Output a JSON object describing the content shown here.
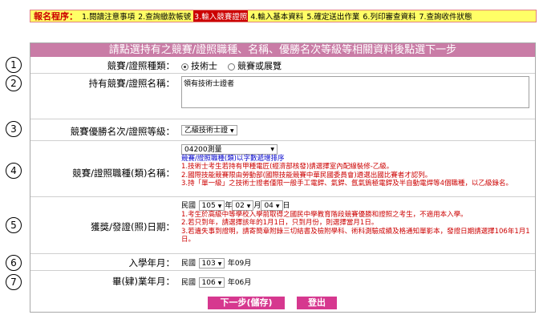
{
  "steps": {
    "label": "報名程序：",
    "items": [
      "1.閱讀注意事項",
      "2.查詢繳款帳號",
      "3.輸入競賽證照",
      "4.輸入基本資料",
      "5.確定送出作業",
      "6.列印審查資料",
      "7.查詢收件狀態"
    ],
    "active_index": 2
  },
  "header": {
    "title": "請點選持有之競賽/證照職種、名稱、優勝名次等級等相關資料後點選下一步"
  },
  "rows": {
    "r1": {
      "num": "1",
      "label": "競賽/證照種類：",
      "options": [
        "技術士",
        "競賽或展覽"
      ],
      "selected": "技術士"
    },
    "r2": {
      "num": "2",
      "label": "持有競賽/證照名稱：",
      "value": "領有技術士證者"
    },
    "r3": {
      "num": "3",
      "label": "競賽優勝名次/證照等級：",
      "value": "乙級技術士證"
    },
    "r4": {
      "num": "4",
      "label": "競賽/證照職種(類)名稱：",
      "select_value": "04200測量",
      "hint": "競賽/證照職種(類)以字數遞增排序",
      "notes": [
        "1.技術士考生若持有甲種電匠(經濟部核發)請選擇室內配線裝修-乙級。",
        "2.國際技能競賽限由勞動部(國際技能競賽中華民國委員會)遴選出國比賽者才認列。",
        "3.持「單一級」之技術士證者僅限一般手工電銲、氣銲、氬氣鎢極電銲及半自動電焊等4個職種，以乙級錄名。"
      ]
    },
    "r5": {
      "num": "5",
      "label": "獲獎/發證(照)日期：",
      "prefix": "民國",
      "year": "105",
      "year_unit": "年",
      "month": "02",
      "month_unit": "月",
      "day": "04",
      "day_unit": "日",
      "notes": [
        "1.考生於高級中等學校入學前取得之國民中學教育階段競賽優勝和證照之考生，不適用本入學。",
        "2.若只到年，請選擇該年的1月1日，只到月份，則選擇當月1日。",
        "3.若遺失事到證明，請寄簡章附錄三切結書及檢附學科、術科測驗成績及格通知單影本，發證日期請選擇106年1月1日。"
      ]
    },
    "r6": {
      "num": "6",
      "label": "入學年月：",
      "prefix": "民國",
      "year": "103",
      "suffix": "年09月"
    },
    "r7": {
      "num": "7",
      "label": "畢(肄)業年月：",
      "prefix": "民國",
      "year": "106",
      "suffix": "年06月"
    }
  },
  "buttons": {
    "next": "下一步(儲存)",
    "logout": "登出"
  },
  "colors": {
    "header_bg": "#c97ca6",
    "button_bg": "#d6388f",
    "steps_bg": "#ffff66",
    "note_red": "#cc0000",
    "note_blue": "#0000cc"
  }
}
